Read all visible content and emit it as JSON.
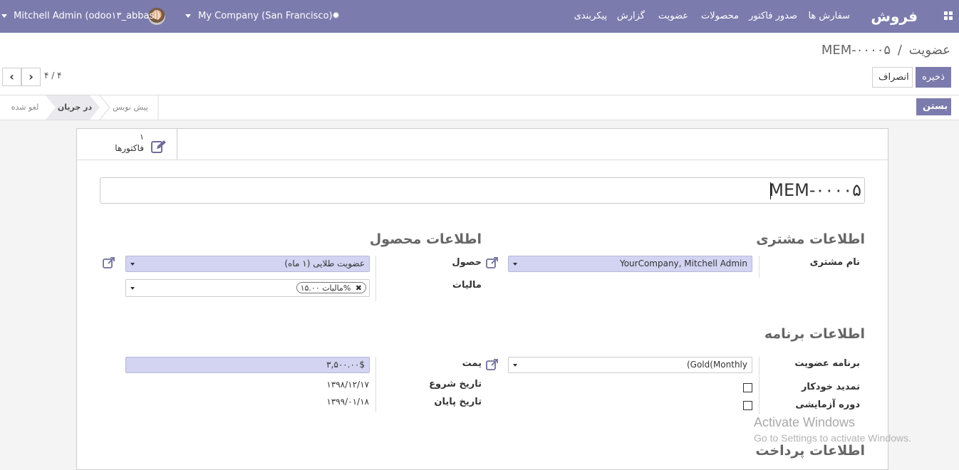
{
  "topbar": {
    "brand": "فروش",
    "menu": [
      "سفارش ها",
      "صدور فاکتور",
      "محصولات",
      "عضویت",
      "گزارش",
      "پیکربندی"
    ],
    "company": "My Company (San Francisco)",
    "user": "Mitchell Admin (odoo۱۳_abbasi)",
    "accent_color": "#7c7bad",
    "icons": [
      "apps-icon",
      "bug-icon",
      "user-avatar"
    ]
  },
  "control_panel": {
    "breadcrumb_parent": "عضویت",
    "breadcrumb_sep": "/",
    "breadcrumb_current": "MEM-۰۰۰۰۵",
    "save_label": "ذخیره",
    "discard_label": "انصراف",
    "pager_value": "۴ / ۴"
  },
  "statusbar": {
    "close_button": "بستن",
    "states": [
      "پیش نویس",
      "در جریان",
      "لغو شده"
    ],
    "active_state": "در جریان"
  },
  "smart_button": {
    "count": "۱",
    "label": "فاکتورها"
  },
  "record": {
    "name": "MEM-۰۰۰۰۵",
    "customer_section": "اطلاعات مشتری",
    "customer_label": "نام مشتری",
    "customer_value": "YourCompany, Mitchell Admin",
    "product_section": "اطلاعات محصول",
    "product_label": "حصول",
    "product_value": "عضویت طلایی (۱ ماه)",
    "taxes_label": "مالیات",
    "tax_tag": "مالیات ۱۵.۰۰%",
    "program_section": "اطلاعات برنامه",
    "program_label": "برنامه عضویت",
    "program_value": "(Gold(Monthly",
    "autorenew_label": "تمدید خودکار",
    "trial_label": "دوره آزمایشی",
    "price_label": "یمت",
    "price_value": "۳,۵۰۰.۰۰$",
    "start_label": "تاریخ شروع",
    "start_value": "۱۳۹۸/۱۲/۱۷",
    "end_label": "تاریخ پایان",
    "end_value": "۱۳۹۹/۰۱/۱۸",
    "payment_section": "اطلاعات پرداخت"
  },
  "watermark": {
    "line1": "Activate Windows",
    "line2": "Go to Settings to activate Windows."
  }
}
